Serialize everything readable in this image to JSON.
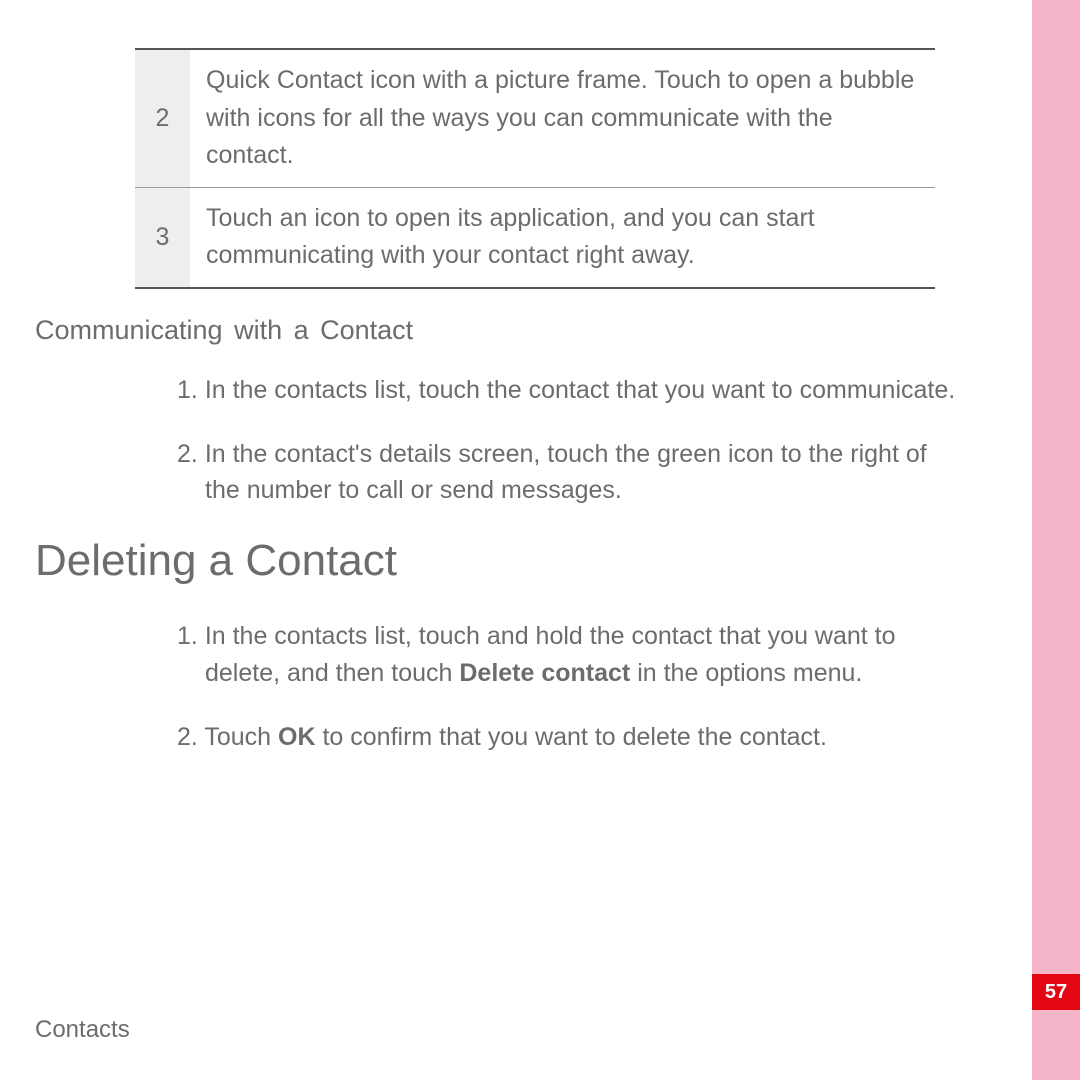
{
  "table": {
    "rows": [
      {
        "num": "2",
        "text": "Quick Contact icon with a picture frame. Touch to open a bubble with icons for all the ways you can communicate with the contact."
      },
      {
        "num": "3",
        "text": "Touch an icon to open its application, and you can start communicating with your contact right away."
      }
    ]
  },
  "subheading": "Communicating with a Contact",
  "communicate_steps": [
    "In the contacts list, touch the contact that you want to communicate.",
    "In the contact's details screen, touch the green icon to the right of the number to call or send messages."
  ],
  "section_heading": "Deleting a Contact",
  "delete_steps_html": [
    "In the contacts list, touch and hold the contact that you want to delete, and then touch <b>Delete contact</b> in the options menu.",
    "Touch <b>OK</b> to confirm that you want to delete the contact."
  ],
  "footer": "Contacts",
  "page_number": "57"
}
